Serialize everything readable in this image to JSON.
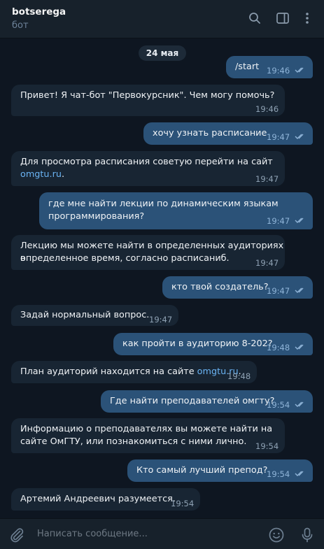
{
  "header": {
    "title": "botserega",
    "subtitle": "бот"
  },
  "chat": {
    "date": "24 мая",
    "messages": [
      {
        "dir": "out",
        "text": "/start",
        "time": "19:46"
      },
      {
        "dir": "in",
        "text": "Привет! Я чат-бот \"Первокурсник\". Чем могу помочь?",
        "time": "19:46"
      },
      {
        "dir": "out",
        "text": "хочу узнать расписание",
        "time": "19:47"
      },
      {
        "dir": "in",
        "text_line1": "Для просмотра расписания советую перейти на сайт",
        "link": "omgtu.ru",
        "link_suffix": ".",
        "time": "19:47"
      },
      {
        "dir": "out",
        "text_line1": "где мне найти лекции по динамическим языкам",
        "text_line2": "программирования?",
        "time": "19:47"
      },
      {
        "dir": "in",
        "text_line1": "Лекцию мы можете найти в определенных аудиториях в",
        "text_line2": "определенное время, согласно расписаниб.",
        "time": "19:47"
      },
      {
        "dir": "out",
        "text": "кто твой создатель?",
        "time": "19:47"
      },
      {
        "dir": "in",
        "text": "Задай нормальный вопрос.",
        "time": "19:47"
      },
      {
        "dir": "out",
        "text": "как пройти в аудиторию 8-202?",
        "time": "19:48"
      },
      {
        "dir": "in",
        "text_prefix": "План аудиторий находится на сайте ",
        "link": "omgtu.ru",
        "link_suffix": ".",
        "time": "19:48"
      },
      {
        "dir": "out",
        "text": "Где найти преподавателей омгту?",
        "time": "19:54"
      },
      {
        "dir": "in",
        "text_line1": "Информацию о преподавателях вы можете найти на",
        "text_line2": "сайте ОмГТУ, или познакомиться с ними лично.",
        "time": "19:54"
      },
      {
        "dir": "out",
        "text": "Кто самый лучший препод?",
        "time": "19:54"
      },
      {
        "dir": "in",
        "text": "Артемий Андреевич разумеется.",
        "time": "19:54"
      }
    ]
  },
  "composer": {
    "placeholder": "Написать сообщение..."
  },
  "icons": [
    "search-icon",
    "sidebar-toggle-icon",
    "more-vertical-icon",
    "attach-icon",
    "emoji-icon",
    "microphone-icon"
  ],
  "colors": {
    "background": "#0e1621",
    "header": "#17212b",
    "incoming_bubble": "#182533",
    "outgoing_bubble": "#2b5278",
    "link": "#6ab3f3"
  }
}
